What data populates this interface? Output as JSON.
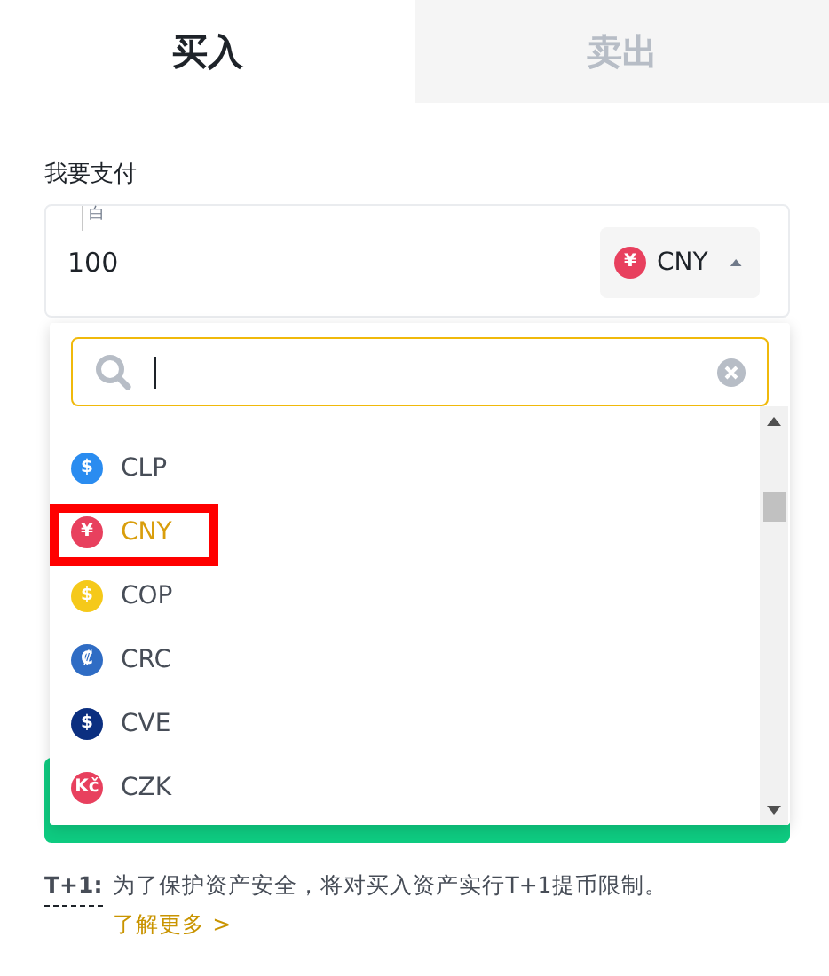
{
  "tabs": [
    {
      "label": "买入",
      "selected": true
    },
    {
      "label": "卖出",
      "selected": false
    }
  ],
  "pay": {
    "label": "我要支付",
    "hint": "白",
    "value": "100",
    "currency": {
      "symbol": "¥",
      "code": "CNY",
      "color": "#e8405e"
    }
  },
  "dropdown": {
    "expanded": true,
    "items": [
      {
        "code": "CLP",
        "symbol": "$",
        "color": "#2a8cf0",
        "selected": false
      },
      {
        "code": "CNY",
        "symbol": "¥",
        "color": "#e8405e",
        "selected": true
      },
      {
        "code": "COP",
        "symbol": "$",
        "color": "#f5c91a",
        "selected": false
      },
      {
        "code": "CRC",
        "symbol": "₡",
        "color": "#2f6cc4",
        "selected": false
      },
      {
        "code": "CVE",
        "symbol": "$",
        "color": "#0b2f80",
        "selected": false
      },
      {
        "code": "CZK",
        "symbol": "Kč",
        "color": "#e8405e",
        "selected": false
      }
    ]
  },
  "notice": {
    "term": "T+1:",
    "text": "为了保护资产安全，将对买入资产实行T+1提币限制。",
    "link": "了解更多 >"
  }
}
